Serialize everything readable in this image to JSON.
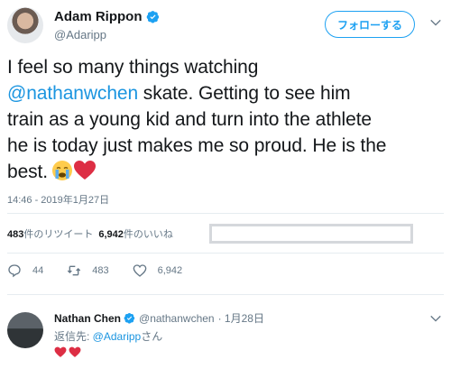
{
  "author": {
    "name": "Adam Rippon",
    "handle": "@Adaripp",
    "follow_label": "フォローする"
  },
  "tweet": {
    "line1": "I feel so many things watching",
    "mention": "@nathanwchen",
    "line2_rest": " skate. Getting to see him",
    "line3": "train as a young kid and turn into the athlete",
    "line4": "he is today just makes me so proud. He is the",
    "line5": "best."
  },
  "timestamp": "14:46 - 2019年1月27日",
  "stats": {
    "retweets_count": "483",
    "retweets_label": "件のリツイート",
    "likes_count": "6,942",
    "likes_label": "件のいいね"
  },
  "actions": {
    "reply_count": "44",
    "retweet_count": "483",
    "like_count": "6,942"
  },
  "reply": {
    "name": "Nathan Chen",
    "handle": "@nathanwchen",
    "date": "· 1月28日",
    "reply_to_prefix": "返信先: ",
    "reply_to_handle": "@Adaripp",
    "reply_to_suffix": "さん"
  },
  "colors": {
    "accent": "#1da1f2",
    "link": "#1b95e0",
    "muted": "#657786",
    "heart": "#e0245e"
  }
}
